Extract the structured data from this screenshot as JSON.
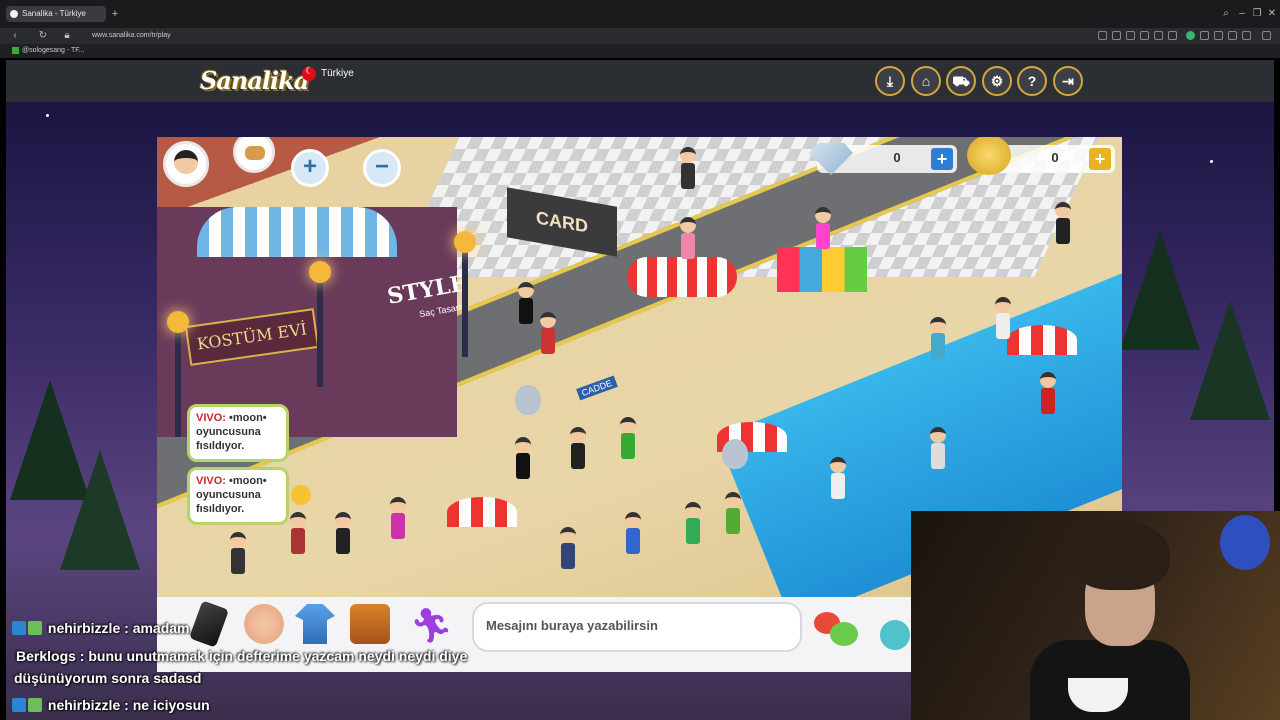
{
  "browser": {
    "tab_title": "Sanalika - Türkiye",
    "new_tab": "+",
    "url": "www.sanalika.com/tr/play",
    "bookmark": "@sologesang - TF..."
  },
  "header": {
    "logo": "Sanalika",
    "country": "Türkiye",
    "buttons": [
      "download-icon",
      "home-icon",
      "cart-icon",
      "gear-icon",
      "help-icon",
      "logout-icon"
    ]
  },
  "game": {
    "diamonds": "0",
    "coins": "0",
    "zoom_in": "+",
    "zoom_out": "−",
    "signs": {
      "kostum": "KOSTÜM EVİ",
      "style": "STYLE",
      "style_sub": "Saç Tasarım",
      "card": "CARD",
      "cadde": "CADDE"
    },
    "whispers": [
      {
        "name": "VIVO:",
        "text": "•moon• oyuncusuna fısıldıyor."
      },
      {
        "name": "VIVO:",
        "text": "•moon• oyuncusuna fısıldıyor."
      }
    ]
  },
  "bottombar": {
    "message_placeholder": "Mesajını buraya yazabilirsin",
    "icons": [
      "phone-icon",
      "handshake-icon",
      "clothes-icon",
      "bag-icon",
      "dance-icon",
      "chat-bubbles-icon",
      "help-face-icon"
    ]
  },
  "chat": [
    {
      "user": "nehirbizzle",
      "text": " : amadam",
      "color": "#ffffff"
    },
    {
      "user": "Berklogs",
      "text": " : bunu unutmamak için defterime yazcam neydi neydi diye",
      "color": "#ffffff"
    },
    {
      "user": "",
      "text": "düşünüyorum sonra sadasd",
      "color": "#ffffff"
    },
    {
      "user": "nehirbizzle",
      "text": " : ne iciyosun",
      "color": "#ffffff"
    }
  ],
  "colors": {
    "accent": "#d6a63c",
    "diamond_plus": "#2d7fd6",
    "coin_plus": "#e6b422"
  }
}
